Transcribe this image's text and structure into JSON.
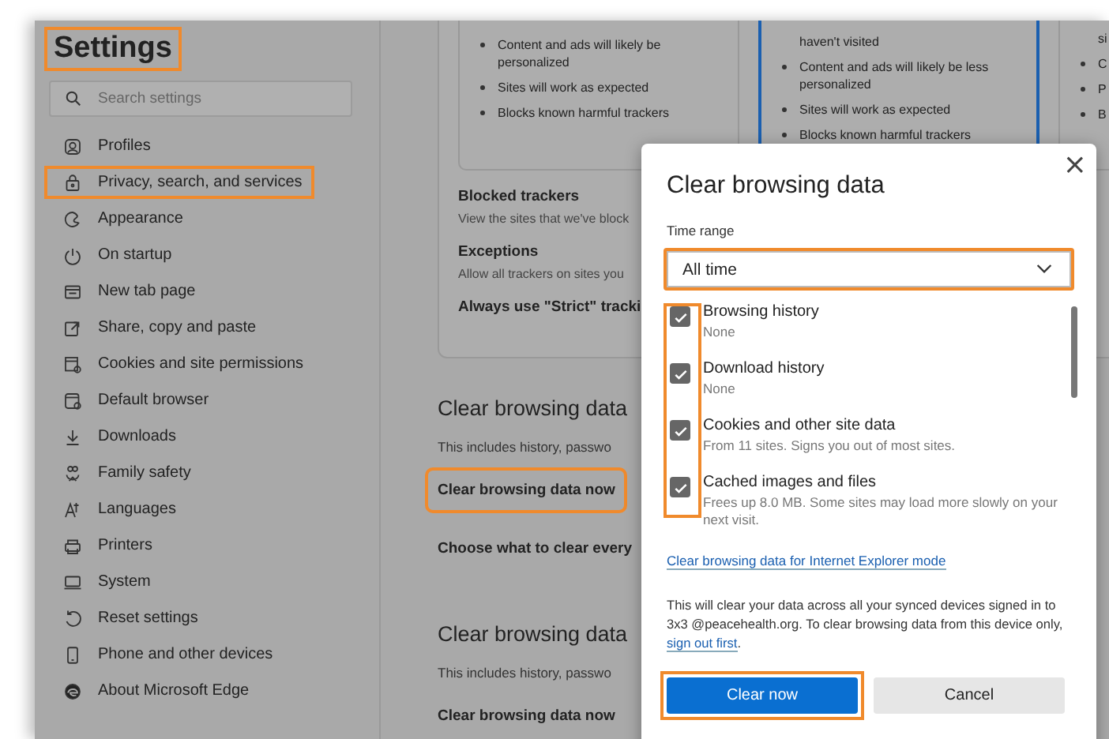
{
  "sidebar": {
    "title": {
      "text": "Settings",
      "highlighted": true
    },
    "search": {
      "placeholder": "Search settings"
    },
    "items": [
      {
        "label": "Profiles",
        "highlighted": false
      },
      {
        "label": "Privacy, search, and services",
        "highlighted": true
      },
      {
        "label": "Appearance",
        "highlighted": false
      },
      {
        "label": "On startup",
        "highlighted": false
      },
      {
        "label": "New tab page",
        "highlighted": false
      },
      {
        "label": "Share, copy and paste",
        "highlighted": false
      },
      {
        "label": "Cookies and site permissions",
        "highlighted": false
      },
      {
        "label": "Default browser",
        "highlighted": false
      },
      {
        "label": "Downloads",
        "highlighted": false
      },
      {
        "label": "Family safety",
        "highlighted": false
      },
      {
        "label": "Languages",
        "highlighted": false
      },
      {
        "label": "Printers",
        "highlighted": false
      },
      {
        "label": "System",
        "highlighted": false
      },
      {
        "label": "Reset settings",
        "highlighted": false
      },
      {
        "label": "Phone and other devices",
        "highlighted": false
      },
      {
        "label": "About Microsoft Edge",
        "highlighted": false
      }
    ]
  },
  "main": {
    "cards": [
      {
        "selected": false,
        "lines": [
          {
            "kind": "bullet",
            "text": "Content and ads will likely be personalized"
          },
          {
            "kind": "bullet",
            "text": "Sites will work as expected"
          },
          {
            "kind": "bullet",
            "text": "Blocks known harmful trackers"
          }
        ]
      },
      {
        "selected": true,
        "lines": [
          {
            "kind": "continuation",
            "text": "haven't visited"
          },
          {
            "kind": "bullet",
            "text": "Content and ads will likely be less personalized"
          },
          {
            "kind": "bullet",
            "text": "Sites will work as expected"
          },
          {
            "kind": "bullet",
            "text": "Blocks known harmful trackers"
          }
        ]
      },
      {
        "selected": false,
        "lines": [
          {
            "kind": "continuation",
            "text": "si"
          },
          {
            "kind": "bullet",
            "text": "C"
          },
          {
            "kind": "bullet",
            "text": "P"
          },
          {
            "kind": "bullet",
            "text": "B"
          }
        ]
      }
    ],
    "tracking_rows": [
      {
        "title": "Blocked trackers",
        "description": "View the sites that we've block"
      },
      {
        "title": "Exceptions",
        "description": "Allow all trackers on sites you"
      },
      {
        "title": "Always use \"Strict\" tracki"
      }
    ],
    "sections": [
      {
        "heading": "Clear browsing data",
        "description": "This includes history, passwo",
        "rows": [
          {
            "label": "Clear browsing data now",
            "highlighted": true
          },
          {
            "label": "Choose what to clear every",
            "highlighted": false
          }
        ]
      },
      {
        "heading": "Clear browsing data",
        "description": "This includes history, passwo",
        "rows": [
          {
            "label": "Clear browsing data now",
            "highlighted": false
          }
        ]
      }
    ]
  },
  "dialog": {
    "title": "Clear browsing data",
    "close": "×",
    "time_range": {
      "label": "Time range",
      "value": "All time",
      "highlighted": true
    },
    "checkboxes_highlighted": true,
    "options": [
      {
        "label": "Browsing history",
        "detail": "None",
        "checked": true
      },
      {
        "label": "Download history",
        "detail": "None",
        "checked": true
      },
      {
        "label": "Cookies and other site data",
        "detail": "From 11 sites. Signs you out of most sites.",
        "checked": true
      },
      {
        "label": "Cached images and files",
        "detail": "Frees up 8.0 MB. Some sites may load more slowly on your next visit.",
        "checked": true
      }
    ],
    "ie_link": "Clear browsing data for Internet Explorer mode",
    "notice": {
      "text": "This will clear your data across all your synced devices signed in to 3x3 @peacehealth.org. To clear browsing data from this device only,",
      "link": "sign out first",
      "end": "."
    },
    "buttons": [
      {
        "label": "Clear now",
        "kind": "primary",
        "highlighted": true
      },
      {
        "label": "Cancel",
        "kind": "secondary",
        "highlighted": false
      }
    ]
  }
}
